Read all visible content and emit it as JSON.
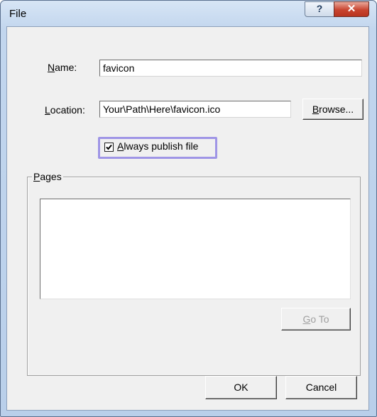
{
  "window": {
    "title": "File",
    "help_glyph": "?",
    "close_glyph": "✕"
  },
  "form": {
    "name_label_u": "N",
    "name_label_rest": "ame:",
    "name_value": "favicon",
    "location_label_u": "L",
    "location_label_rest": "ocation:",
    "location_value": "Your\\Path\\Here\\favicon.ico",
    "browse_u": "B",
    "browse_rest": "rowse...",
    "always_publish_u": "A",
    "always_publish_rest": "lways publish file",
    "always_publish_checked": true
  },
  "pages_group": {
    "title_u": "P",
    "title_rest": "ages",
    "items": [],
    "goto_u": "G",
    "goto_rest": "o To"
  },
  "footer": {
    "ok_label": "OK",
    "cancel_label": "Cancel"
  }
}
